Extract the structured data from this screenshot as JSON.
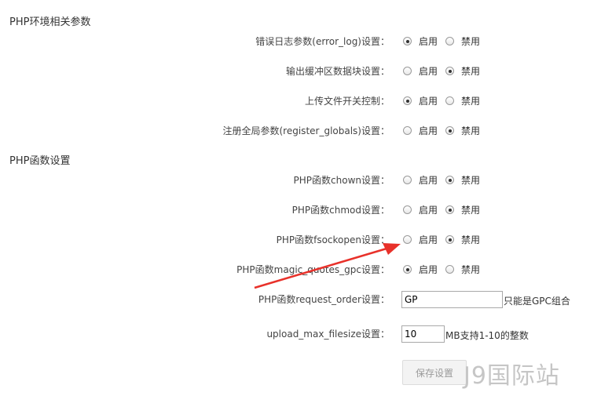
{
  "sections": [
    {
      "title": "PHP环境相关参数"
    },
    {
      "title": "PHP函数设置"
    }
  ],
  "options": {
    "enable": "启用",
    "disable": "禁用"
  },
  "rows": [
    {
      "label": "错误日志参数(error_log)设置：",
      "selected": "enable"
    },
    {
      "label": "输出缓冲区数据块设置：",
      "selected": "disable"
    },
    {
      "label": "上传文件开关控制：",
      "selected": "enable"
    },
    {
      "label": "注册全局参数(register_globals)设置：",
      "selected": "disable"
    },
    {
      "label": "PHP函数chown设置：",
      "selected": "disable"
    },
    {
      "label": "PHP函数chmod设置：",
      "selected": "disable"
    },
    {
      "label": "PHP函数fsockopen设置：",
      "selected": "disable"
    },
    {
      "label": "PHP函数magic_quotes_gpc设置：",
      "selected": "enable"
    }
  ],
  "request_order": {
    "label": "PHP函数request_order设置：",
    "value": "GP",
    "hint": "只能是GPC组合"
  },
  "upload_max_filesize": {
    "label": "upload_max_filesize设置：",
    "value": "10",
    "hint": "MB支持1-10的整数"
  },
  "save_button": {
    "label": "保存设置"
  },
  "watermark": {
    "text": "J9国际站"
  },
  "colors": {
    "arrow": "#e8312a",
    "text": "#333333"
  }
}
